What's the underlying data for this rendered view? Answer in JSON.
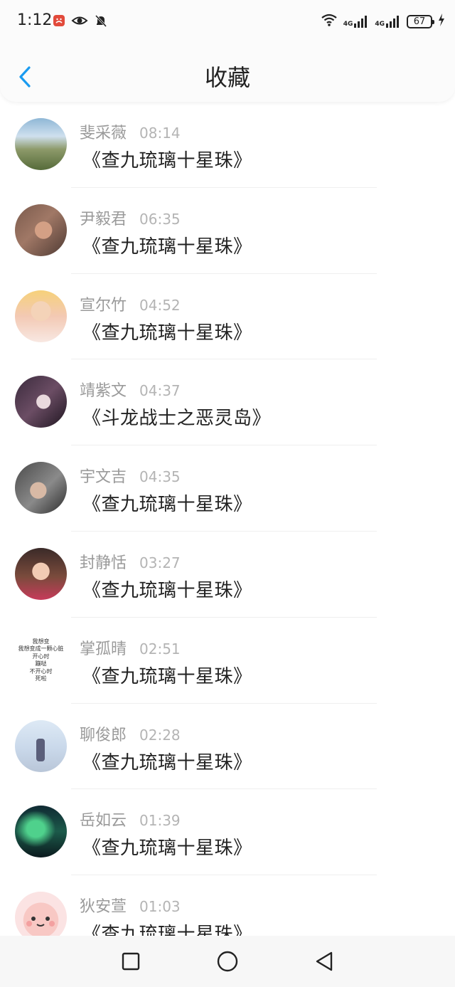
{
  "status_bar": {
    "time": "1:12",
    "battery": "67",
    "network_1": "4G",
    "network_2": "4G"
  },
  "header": {
    "title": "收藏",
    "accent_color": "#1a9bf0"
  },
  "favorites": [
    {
      "name": "斐采薇",
      "time": "08:14",
      "title": "《查九琉璃十星珠》"
    },
    {
      "name": "尹毅君",
      "time": "06:35",
      "title": "《查九琉璃十星珠》"
    },
    {
      "name": "宣尔竹",
      "time": "04:52",
      "title": "《查九琉璃十星珠》"
    },
    {
      "name": "靖紫文",
      "time": "04:37",
      "title": "《斗龙战士之恶灵岛》"
    },
    {
      "name": "宇文吉",
      "time": "04:35",
      "title": "《查九琉璃十星珠》"
    },
    {
      "name": "封静恬",
      "time": "03:27",
      "title": "《查九琉璃十星珠》"
    },
    {
      "name": "掌孤晴",
      "time": "02:51",
      "title": "《查九琉璃十星珠》"
    },
    {
      "name": "聊俊郎",
      "time": "02:28",
      "title": "《查九琉璃十星珠》"
    },
    {
      "name": "岳如云",
      "time": "01:39",
      "title": "《查九琉璃十星珠》"
    },
    {
      "name": "狄安萱",
      "time": "01:03",
      "title": "《查九琉璃十星珠》"
    }
  ],
  "avatar_poem": [
    "我想变",
    "我想变成一颗心脏",
    "开心时",
    "蹦哒",
    "不开心时",
    "死啦"
  ]
}
